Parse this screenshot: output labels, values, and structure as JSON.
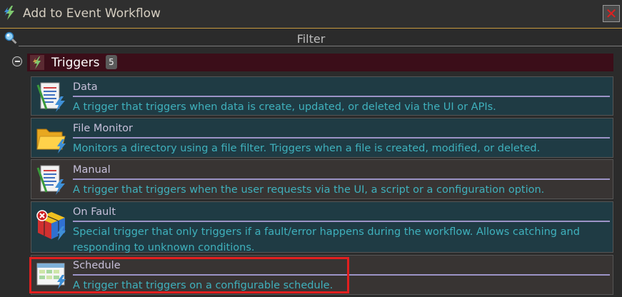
{
  "window": {
    "title": "Add to Event Workflow"
  },
  "filter": {
    "label": "Filter"
  },
  "group": {
    "label": "Triggers",
    "count": "5"
  },
  "items": [
    {
      "name": "Data",
      "description": "A trigger that triggers when data is create, updated, or deleted via the UI or APIs."
    },
    {
      "name": "File Monitor",
      "description": "Monitors a directory using a file filter. Triggers when a file is created, modified, or deleted."
    },
    {
      "name": "Manual",
      "description": "A trigger that triggers when the user requests via the UI, a script or a configuration option."
    },
    {
      "name": "On Fault",
      "description": "Special trigger that only triggers if a fault/error happens during the workflow. Allows catching and responding to unknown conditions."
    },
    {
      "name": "Schedule",
      "description": "A trigger that triggers on a configurable schedule."
    }
  ],
  "icons": {
    "title": "lightning-icon",
    "close": "close-icon",
    "filter": "magnifier-icon",
    "group_toggle": "collapse-icon",
    "data": "document-icon",
    "file_monitor": "folder-icon",
    "manual": "document-icon",
    "on_fault": "cube-error-icon",
    "schedule": "calendar-icon"
  },
  "colors": {
    "accent": "#c79a3f",
    "group_bg": "#3b0e19",
    "item_teal": "#1f3b44",
    "item_gray": "#383433",
    "desc_text": "#3fb1bd",
    "highlight": "#e21f1f"
  }
}
